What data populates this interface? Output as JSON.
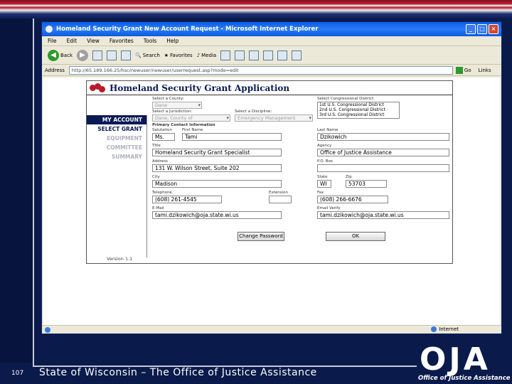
{
  "slide": {
    "page_number": "107",
    "footer": "State of Wisconsin – The Office of Justice Assistance",
    "logo": "OJA",
    "logo_subtitle": "Office of Justice Assistance"
  },
  "browser": {
    "title": "Homeland Security Grant New Account Request - Microsoft Internet Explorer",
    "menu": [
      "File",
      "Edit",
      "View",
      "Favorites",
      "Tools",
      "Help"
    ],
    "toolbar": {
      "back": "Back",
      "search": "Search",
      "favorites": "Favorites",
      "media": "Media"
    },
    "address_label": "Address",
    "address_value": "http://65.189.166.25/hsc/newuser/newuser/userrequest.asp?mode=edit",
    "go_label": "Go",
    "links_label": "Links",
    "status_zone": "Internet"
  },
  "app": {
    "title": "Homeland Security Grant Application",
    "version": "Version 1.1",
    "nav": [
      {
        "label": "MY ACCOUNT",
        "state": "active"
      },
      {
        "label": "SELECT GRANT",
        "state": "normal"
      },
      {
        "label": "EQUIPMENT",
        "state": "disabled"
      },
      {
        "label": "COMMITTEE",
        "state": "disabled"
      },
      {
        "label": "SUMMARY",
        "state": "disabled"
      }
    ],
    "labels": {
      "select_county": "Select a County:",
      "select_district": "Select Congressional District:",
      "select_jurisdiction": "Select a Jurisdiction:",
      "select_discipline": "Select a Discipline:",
      "primary_contact": "Primary Contact Information",
      "salutation": "Salutation",
      "first_name": "First Name",
      "last_name": "Last Name",
      "title": "Title",
      "agency": "Agency",
      "address": "Address",
      "po_box": "P.O. Box",
      "city": "City",
      "state": "State",
      "zip": "Zip",
      "telephone": "Telephone",
      "extension": "Extension",
      "fax": "Fax",
      "email": "E-Mail",
      "email_verify": "Email Verify"
    },
    "values": {
      "county": "Dane",
      "jurisdiction": "Dane, County of",
      "discipline": "Emergency Management",
      "districts": [
        "1st U.S. Congressional District",
        "2nd U.S. Congressional District",
        "3rd U.S. Congressional District"
      ],
      "salutation": "Ms.",
      "first_name": "Tami",
      "last_name": "Dzikowich",
      "title": "Homeland Security Grant Specialist",
      "agency": "Office of Justice Assistance",
      "address": "131 W. Wilson Street, Suite 202",
      "po_box": "",
      "city": "Madison",
      "state": "WI",
      "zip": "53703",
      "telephone": "(608) 261-4545",
      "extension": "",
      "fax": "(608) 266-6676",
      "email": "tami.dzikowich@oja.state.wi.us",
      "email_verify": "tami.dzikowich@oja.state.wi.us"
    },
    "buttons": {
      "change_password": "Change Password",
      "ok": "OK"
    }
  }
}
